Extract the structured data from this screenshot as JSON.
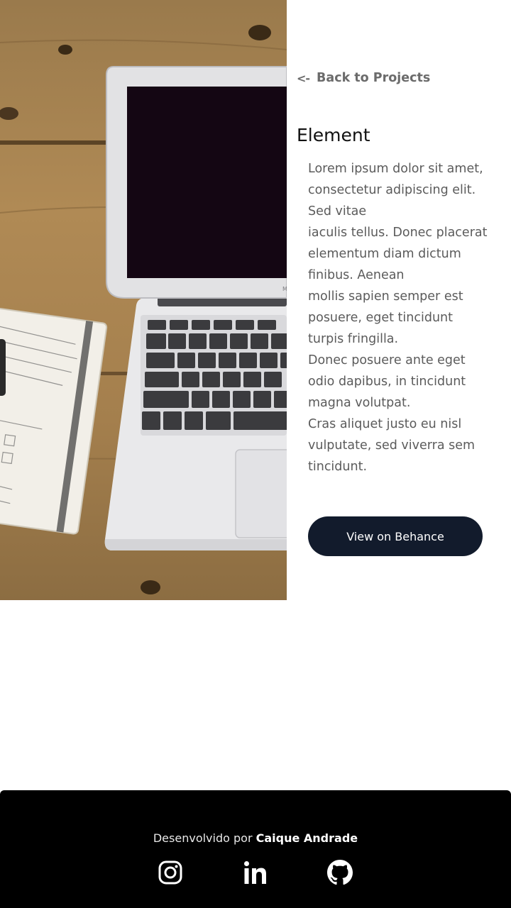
{
  "nav": {
    "back_arrow": "<-",
    "back_label": "Back to Projects"
  },
  "project": {
    "title": "Element",
    "description_lines": [
      "Lorem ipsum dolor sit amet,",
      "consectetur adipiscing elit.",
      "Sed vitae",
      "iaculis tellus. Donec placerat",
      "elementum diam dictum",
      "finibus. Aenean",
      "mollis sapien semper est",
      "posuere, eget tincidunt",
      "turpis fringilla.",
      "Donec posuere ante eget",
      "odio dapibus, in tincidunt",
      "magna volutpat.",
      "Cras aliquet justo eu nisl",
      "vulputate, sed viverra sem",
      "tincidunt."
    ],
    "cta_label": "View on Behance"
  },
  "footer": {
    "credit_prefix": "Desenvolvido por",
    "credit_name": "Caique Andrade",
    "social": [
      {
        "name": "instagram-icon"
      },
      {
        "name": "linkedin-icon"
      },
      {
        "name": "github-icon"
      }
    ]
  },
  "colors": {
    "button_bg": "#121b2c",
    "footer_bg": "#000000",
    "link_gray": "#6b6b6b",
    "text_gray": "#5b5b5b"
  }
}
